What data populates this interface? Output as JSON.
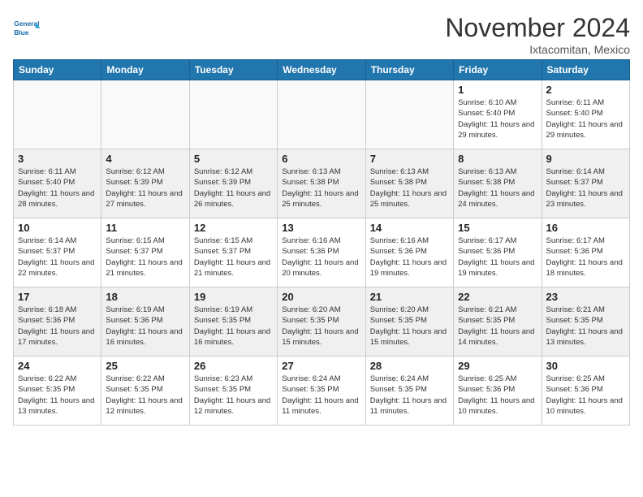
{
  "header": {
    "logo_line1": "General",
    "logo_line2": "Blue",
    "month": "November 2024",
    "location": "Ixtacomitan, Mexico"
  },
  "weekdays": [
    "Sunday",
    "Monday",
    "Tuesday",
    "Wednesday",
    "Thursday",
    "Friday",
    "Saturday"
  ],
  "weeks": [
    [
      {
        "day": "",
        "info": ""
      },
      {
        "day": "",
        "info": ""
      },
      {
        "day": "",
        "info": ""
      },
      {
        "day": "",
        "info": ""
      },
      {
        "day": "",
        "info": ""
      },
      {
        "day": "1",
        "info": "Sunrise: 6:10 AM\nSunset: 5:40 PM\nDaylight: 11 hours and 29 minutes."
      },
      {
        "day": "2",
        "info": "Sunrise: 6:11 AM\nSunset: 5:40 PM\nDaylight: 11 hours and 29 minutes."
      }
    ],
    [
      {
        "day": "3",
        "info": "Sunrise: 6:11 AM\nSunset: 5:40 PM\nDaylight: 11 hours and 28 minutes."
      },
      {
        "day": "4",
        "info": "Sunrise: 6:12 AM\nSunset: 5:39 PM\nDaylight: 11 hours and 27 minutes."
      },
      {
        "day": "5",
        "info": "Sunrise: 6:12 AM\nSunset: 5:39 PM\nDaylight: 11 hours and 26 minutes."
      },
      {
        "day": "6",
        "info": "Sunrise: 6:13 AM\nSunset: 5:38 PM\nDaylight: 11 hours and 25 minutes."
      },
      {
        "day": "7",
        "info": "Sunrise: 6:13 AM\nSunset: 5:38 PM\nDaylight: 11 hours and 25 minutes."
      },
      {
        "day": "8",
        "info": "Sunrise: 6:13 AM\nSunset: 5:38 PM\nDaylight: 11 hours and 24 minutes."
      },
      {
        "day": "9",
        "info": "Sunrise: 6:14 AM\nSunset: 5:37 PM\nDaylight: 11 hours and 23 minutes."
      }
    ],
    [
      {
        "day": "10",
        "info": "Sunrise: 6:14 AM\nSunset: 5:37 PM\nDaylight: 11 hours and 22 minutes."
      },
      {
        "day": "11",
        "info": "Sunrise: 6:15 AM\nSunset: 5:37 PM\nDaylight: 11 hours and 21 minutes."
      },
      {
        "day": "12",
        "info": "Sunrise: 6:15 AM\nSunset: 5:37 PM\nDaylight: 11 hours and 21 minutes."
      },
      {
        "day": "13",
        "info": "Sunrise: 6:16 AM\nSunset: 5:36 PM\nDaylight: 11 hours and 20 minutes."
      },
      {
        "day": "14",
        "info": "Sunrise: 6:16 AM\nSunset: 5:36 PM\nDaylight: 11 hours and 19 minutes."
      },
      {
        "day": "15",
        "info": "Sunrise: 6:17 AM\nSunset: 5:36 PM\nDaylight: 11 hours and 19 minutes."
      },
      {
        "day": "16",
        "info": "Sunrise: 6:17 AM\nSunset: 5:36 PM\nDaylight: 11 hours and 18 minutes."
      }
    ],
    [
      {
        "day": "17",
        "info": "Sunrise: 6:18 AM\nSunset: 5:36 PM\nDaylight: 11 hours and 17 minutes."
      },
      {
        "day": "18",
        "info": "Sunrise: 6:19 AM\nSunset: 5:36 PM\nDaylight: 11 hours and 16 minutes."
      },
      {
        "day": "19",
        "info": "Sunrise: 6:19 AM\nSunset: 5:35 PM\nDaylight: 11 hours and 16 minutes."
      },
      {
        "day": "20",
        "info": "Sunrise: 6:20 AM\nSunset: 5:35 PM\nDaylight: 11 hours and 15 minutes."
      },
      {
        "day": "21",
        "info": "Sunrise: 6:20 AM\nSunset: 5:35 PM\nDaylight: 11 hours and 15 minutes."
      },
      {
        "day": "22",
        "info": "Sunrise: 6:21 AM\nSunset: 5:35 PM\nDaylight: 11 hours and 14 minutes."
      },
      {
        "day": "23",
        "info": "Sunrise: 6:21 AM\nSunset: 5:35 PM\nDaylight: 11 hours and 13 minutes."
      }
    ],
    [
      {
        "day": "24",
        "info": "Sunrise: 6:22 AM\nSunset: 5:35 PM\nDaylight: 11 hours and 13 minutes."
      },
      {
        "day": "25",
        "info": "Sunrise: 6:22 AM\nSunset: 5:35 PM\nDaylight: 11 hours and 12 minutes."
      },
      {
        "day": "26",
        "info": "Sunrise: 6:23 AM\nSunset: 5:35 PM\nDaylight: 11 hours and 12 minutes."
      },
      {
        "day": "27",
        "info": "Sunrise: 6:24 AM\nSunset: 5:35 PM\nDaylight: 11 hours and 11 minutes."
      },
      {
        "day": "28",
        "info": "Sunrise: 6:24 AM\nSunset: 5:35 PM\nDaylight: 11 hours and 11 minutes."
      },
      {
        "day": "29",
        "info": "Sunrise: 6:25 AM\nSunset: 5:36 PM\nDaylight: 11 hours and 10 minutes."
      },
      {
        "day": "30",
        "info": "Sunrise: 6:25 AM\nSunset: 5:36 PM\nDaylight: 11 hours and 10 minutes."
      }
    ]
  ]
}
